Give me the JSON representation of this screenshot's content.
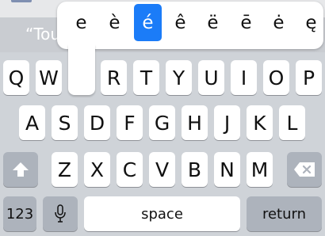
{
  "suggestion": {
    "text": "“Tou"
  },
  "accent_popup": {
    "options": [
      "e",
      "è",
      "é",
      "ê",
      "ë",
      "ē",
      "ė",
      "ę"
    ],
    "selected_index": 2
  },
  "keyboard": {
    "row1": [
      "Q",
      "W",
      "R",
      "T",
      "Y",
      "U",
      "I",
      "O",
      "P"
    ],
    "row2": [
      "A",
      "S",
      "D",
      "F",
      "G",
      "H",
      "J",
      "K",
      "L"
    ],
    "row3": [
      "Z",
      "X",
      "C",
      "V",
      "B",
      "N",
      "M"
    ],
    "numbers_label": "123",
    "space_label": "space",
    "return_label": "return"
  },
  "icons": {
    "shift": "shift-arrow-icon",
    "mic": "microphone-icon",
    "delete": "backspace-icon"
  },
  "colors": {
    "accent": "#1b7cf8",
    "keyboard_bg": "#cfd3d8",
    "dark_key": "#adb3bc"
  }
}
